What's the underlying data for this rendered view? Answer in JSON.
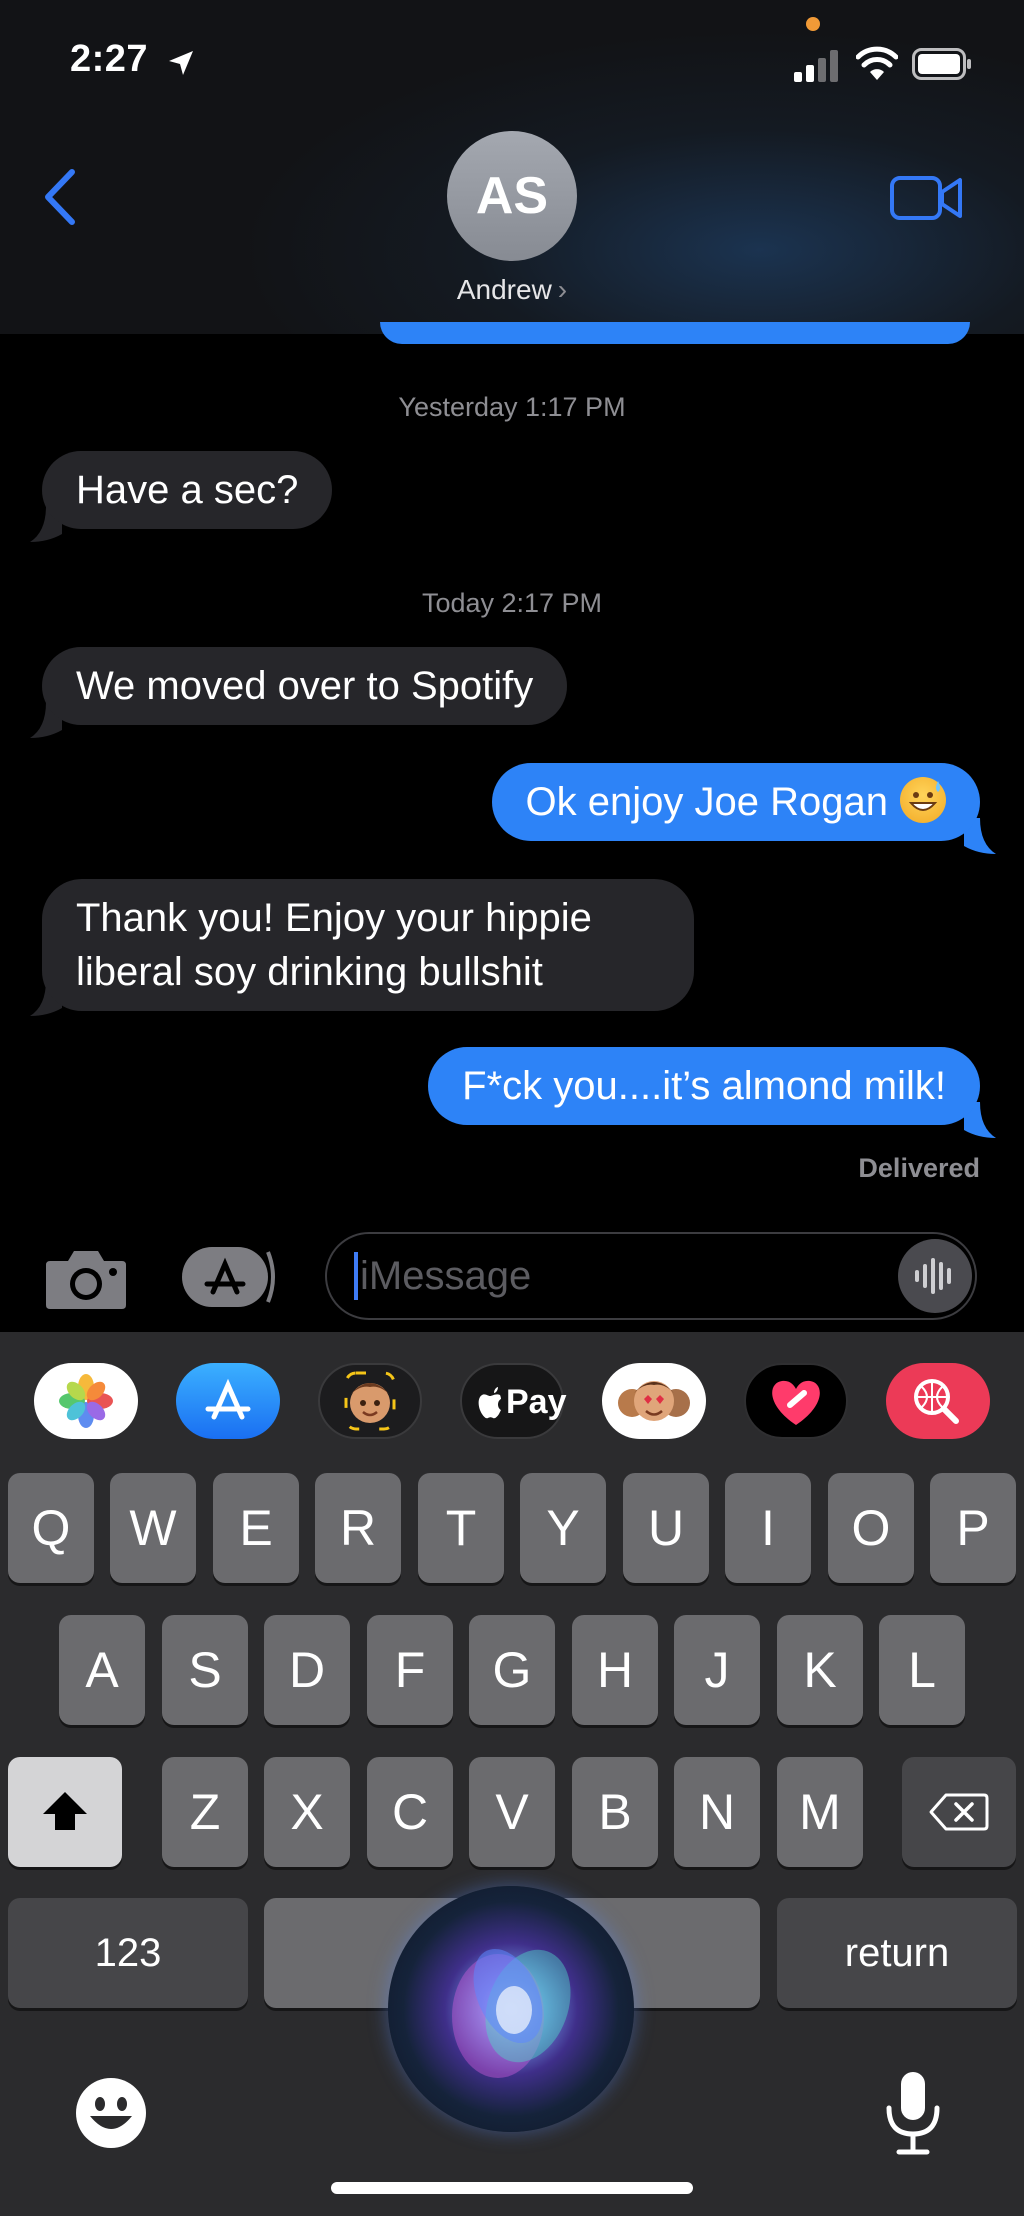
{
  "status_bar": {
    "time": "2:27"
  },
  "header": {
    "avatar_initials": "AS",
    "contact_name": "Andrew",
    "contact_chevron": "›"
  },
  "conversation": {
    "timestamp_1": "Yesterday 1:17 PM",
    "msg_1": "Have a sec?",
    "timestamp_2": "Today 2:17 PM",
    "msg_2": "We moved over to Spotify",
    "msg_3": "Ok enjoy Joe Rogan",
    "msg_3_emoji": "grinning-sweat-emoji",
    "msg_4_line1": "Thank you! Enjoy your hippie",
    "msg_4_line2": "liberal soy drinking bullshit",
    "msg_5": "F*ck you....it’s almond milk!",
    "delivered": "Delivered"
  },
  "composer": {
    "placeholder": "iMessage"
  },
  "app_drawer": {
    "icons": [
      "photos-icon",
      "app-store-icon",
      "memoji-icon",
      "apple-pay-icon",
      "memoji-stickers-icon",
      "digital-touch-icon",
      "image-search-icon"
    ],
    "apple_pay_label": "Pay"
  },
  "keyboard": {
    "row1": [
      "Q",
      "W",
      "E",
      "R",
      "T",
      "Y",
      "U",
      "I",
      "O",
      "P"
    ],
    "row2": [
      "A",
      "S",
      "D",
      "F",
      "G",
      "H",
      "J",
      "K",
      "L"
    ],
    "row3": [
      "Z",
      "X",
      "C",
      "V",
      "B",
      "N",
      "M"
    ],
    "numbers_label": "123",
    "return_label": "return"
  },
  "colors": {
    "outgoing": "#2d83f7",
    "incoming": "#26262a",
    "accent": "#3478f6"
  }
}
